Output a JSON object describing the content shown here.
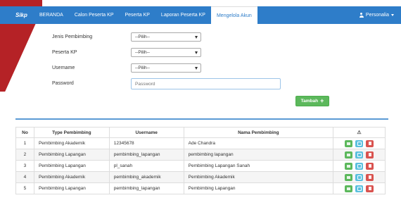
{
  "navbar": {
    "brand": "Sikp",
    "items": [
      "BERANDA",
      "Calon Peserta KP",
      "Peserta KP",
      "Laporan Peserta KP",
      "Mengelola Akun"
    ],
    "active_index": 4,
    "user_label": "Personalia"
  },
  "form": {
    "jenis_label": "Jenis Pembimbing",
    "jenis_value": "--Pilih--",
    "peserta_label": "Peserta KP",
    "peserta_value": "--Pilih--",
    "username_label": "Username",
    "username_value": "--Pilih--",
    "password_label": "Password",
    "password_placeholder": "Password",
    "tambah_label": "Tambah"
  },
  "table": {
    "headers": [
      "No",
      "Type Pembimbing",
      "Username",
      "Nama Pembimbing",
      "⚠"
    ],
    "rows": [
      {
        "no": "1",
        "type": "Pembimbing Akademik",
        "username": "12345678",
        "nama": "Ade Chandra"
      },
      {
        "no": "2",
        "type": "Pembimbing Lapangan",
        "username": "pembimbing_lapangan",
        "nama": "pembimbing lapangan"
      },
      {
        "no": "3",
        "type": "Pembimbing Lapangan",
        "username": "pl_sanah",
        "nama": "Pembimbing Lapangan Sanah"
      },
      {
        "no": "4",
        "type": "Pembimbing Akademik",
        "username": "pembimbing_akademik",
        "nama": "Pembimbing Akademik"
      },
      {
        "no": "5",
        "type": "Pembimbing Lapangan",
        "username": "pembimbing_lapangan",
        "nama": "Pembimbing Lapangan"
      }
    ]
  },
  "colors": {
    "navbar": "#2e7dc9",
    "accent_red": "#b52226",
    "success": "#5cb85c",
    "info": "#5bc0de",
    "danger": "#d9534f"
  },
  "icons": {
    "user": "user-icon",
    "caret": "caret-down-icon",
    "plus": "plus-icon",
    "view": "view-icon",
    "edit": "edit-icon",
    "delete": "trash-icon"
  }
}
